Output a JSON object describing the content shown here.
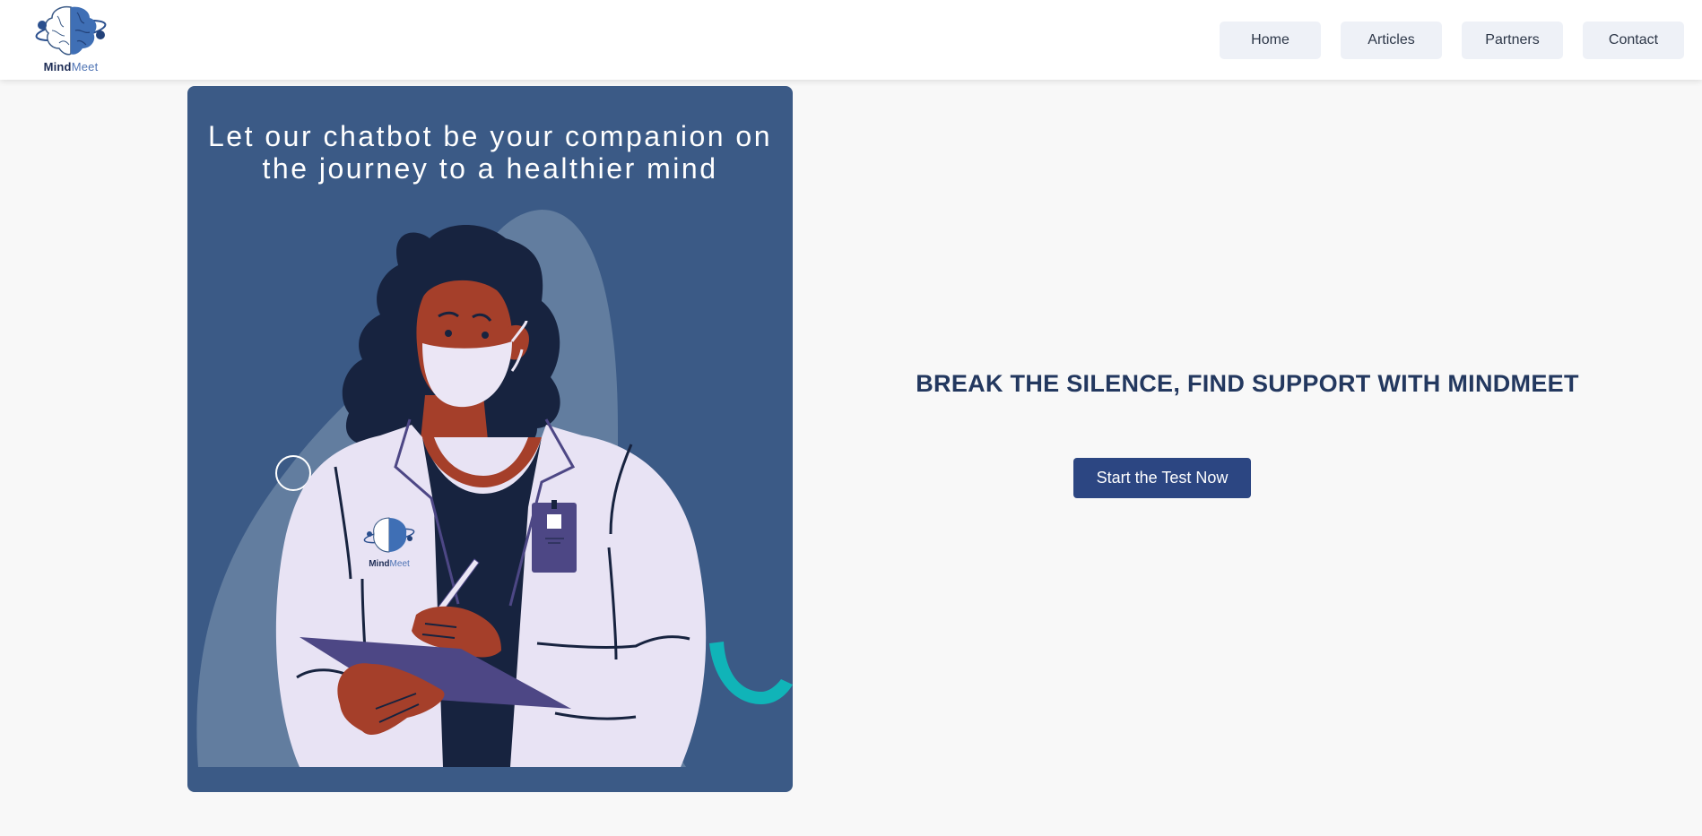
{
  "brand": {
    "name_bold": "Mind",
    "name_light": "Meet",
    "logo_icon": "brain-globe-icon",
    "colors": {
      "primary": "#2c4682",
      "dark": "#23385f",
      "accent": "#4f74b4"
    }
  },
  "nav": {
    "items": [
      {
        "label": "Home"
      },
      {
        "label": "Articles"
      },
      {
        "label": "Partners"
      },
      {
        "label": "Contact"
      }
    ]
  },
  "hero": {
    "heading_line1": "Let our chatbot be your companion on",
    "heading_line2": "the journey to a healthier mind",
    "illustration": "doctor-with-clipboard-illustration",
    "badge_bold": "Mind",
    "badge_light": "Meet",
    "card_color": "#3b5a86"
  },
  "main": {
    "tagline": "BREAK THE SILENCE, FIND SUPPORT WITH MINDMEET",
    "cta_label": "Start the Test Now"
  }
}
